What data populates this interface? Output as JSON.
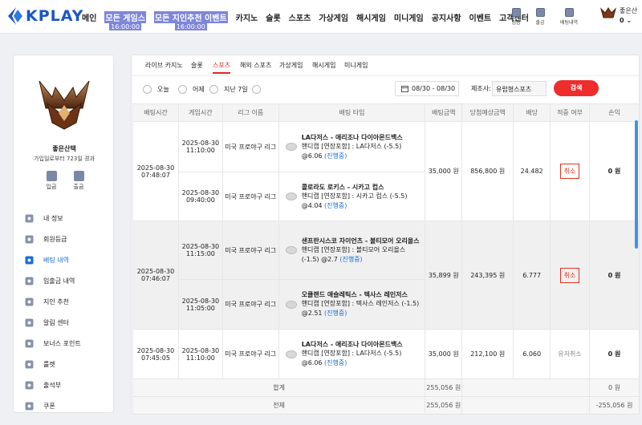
{
  "logo": {
    "text": "KPLAY"
  },
  "nav": [
    {
      "label": "메인"
    },
    {
      "label": "모든 게임스",
      "sub": "16:00:00",
      "highlight": true
    },
    {
      "label": "모든 지인추천 이벤트",
      "sub": "16:00:00",
      "highlight": true
    },
    {
      "label": "카지노"
    },
    {
      "label": "슬롯"
    },
    {
      "label": "스포츠"
    },
    {
      "label": "가상게임"
    },
    {
      "label": "해시게임"
    },
    {
      "label": "미니게임"
    },
    {
      "label": "공지사항"
    },
    {
      "label": "이벤트"
    },
    {
      "label": "고객센터"
    }
  ],
  "header_icons": [
    {
      "label": "입금",
      "icon": "deposit-icon"
    },
    {
      "label": "출금",
      "icon": "withdraw-icon"
    },
    {
      "label": "배팅내역",
      "icon": "history-icon"
    }
  ],
  "user": {
    "name": "좋은산",
    "balance": "0"
  },
  "sidebar": {
    "name": "좋은산택",
    "desc": "가입일로부터 723일 경과",
    "deposit": "입금",
    "withdraw": "출금",
    "menu": [
      {
        "label": "내 정보",
        "icon": "user-icon"
      },
      {
        "label": "회원등급",
        "icon": "grade-icon"
      },
      {
        "label": "배팅 내역",
        "icon": "betting-history-icon",
        "active": true
      },
      {
        "label": "입출금 내역",
        "icon": "transaction-icon"
      },
      {
        "label": "지인 추천",
        "icon": "referral-icon"
      },
      {
        "label": "알림 센터",
        "icon": "bell-icon"
      },
      {
        "label": "보너스 포인트",
        "icon": "bonus-icon"
      },
      {
        "label": "룰렛",
        "icon": "roulette-icon"
      },
      {
        "label": "출석부",
        "icon": "attendance-icon"
      },
      {
        "label": "쿠폰",
        "icon": "coupon-icon"
      }
    ]
  },
  "tabs": [
    "라이브 카지노",
    "슬롯",
    "스포츠",
    "해외 스포츠",
    "가상게임",
    "해시게임",
    "미니게임"
  ],
  "filters": {
    "today": "오늘",
    "yesterday": "어제",
    "week": "지난 7일",
    "date_range": "08/30 - 08/30",
    "maker_label": "제조사:",
    "maker_value": "유럽형스포츠",
    "search": "검색"
  },
  "table": {
    "headers": [
      "배팅시간",
      "게임시간",
      "리그 이름",
      "배팅 타입",
      "배팅금액",
      "당첨예상금액",
      "배당",
      "적중 여부",
      "손익"
    ],
    "bets": [
      {
        "time": "2025-08-30 07:48:07",
        "amount": "35,000 원",
        "expected": "856,800 원",
        "odds": "24.482",
        "status": "취소",
        "status_btn": true,
        "profit": "0 원",
        "games": [
          {
            "game_time": "2025-08-30 11:10:00",
            "league": "미국 프로야구 리그",
            "match": "LA다저스 - 애리조나 다이아몬드백스",
            "detail": "핸디캡 [연장포함] : LA다저스 (-5.5) @6.06",
            "progress": "(진행중)"
          },
          {
            "game_time": "2025-08-30 09:40:00",
            "league": "미국 프로야구 리그",
            "match": "콜로라도 로키스 - 시카고 컵스",
            "detail": "핸디캡 [연장포함] : 시카고 컵스 (-5.5) @4.04",
            "progress": "(진행중)"
          }
        ]
      },
      {
        "time": "2025-08-30 07:46:07",
        "amount": "35,899 원",
        "expected": "243,395 원",
        "odds": "6.777",
        "status": "취소",
        "status_btn": true,
        "profit": "0 원",
        "games": [
          {
            "game_time": "2025-08-30 11:15:00",
            "league": "미국 프로야구 리그",
            "match": "샌프란시스코 자이언츠 - 볼티모어 오리올스",
            "detail": "핸디캡 [연장포함] : 볼티모어 오리올스 (-1.5) @2.7",
            "progress": "(진행중)"
          },
          {
            "game_time": "2025-08-30 11:05:00",
            "league": "미국 프로야구 리그",
            "match": "오클랜드 애슬레틱스 - 텍사스 레인저스",
            "detail": "핸디캡 [연장포함] : 텍사스 레인저스 (-1.5) @2.51",
            "progress": "(진행중)"
          }
        ]
      },
      {
        "time": "2025-08-30 07:45:05",
        "amount": "35,000 원",
        "expected": "212,100 원",
        "odds": "6.060",
        "status": "유저취소",
        "status_btn": false,
        "profit": "0 원",
        "games": [
          {
            "game_time": "2025-08-30 11:10:00",
            "league": "미국 프로야구 리그",
            "match": "LA다저스 - 애리조나 다이아몬드백스",
            "detail": "핸디캡 [연장포함] : LA다저스 (-5.5) @6.06",
            "progress": "(진행중)"
          }
        ]
      }
    ],
    "totals": [
      {
        "label": "합계",
        "amount": "255,056 원",
        "profit": "0 원"
      },
      {
        "label": "전체",
        "amount": "255,056 원",
        "profit": "-255,056 원"
      }
    ]
  }
}
